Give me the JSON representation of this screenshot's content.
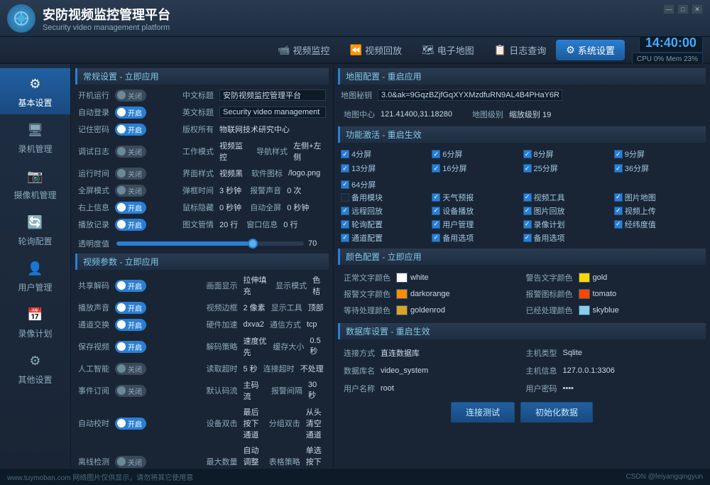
{
  "app": {
    "title": "安防视频监控管理平台",
    "subtitle": "Security video management platform",
    "time": "14:40:00",
    "cpu": "CPU 0%",
    "mem": "Mem 23%"
  },
  "nav": {
    "items": [
      {
        "label": "视频监控",
        "icon": "📹",
        "active": false
      },
      {
        "label": "视频回放",
        "icon": "⏪",
        "active": false
      },
      {
        "label": "电子地图",
        "icon": "🗺",
        "active": false
      },
      {
        "label": "日志查询",
        "icon": "📋",
        "active": false
      },
      {
        "label": "系统设置",
        "icon": "⚙",
        "active": true
      }
    ]
  },
  "sidebar": {
    "items": [
      {
        "label": "基本设置",
        "icon": "⚙",
        "active": true
      },
      {
        "label": "录机管理",
        "icon": "🖥",
        "active": false
      },
      {
        "label": "摄像机管理",
        "icon": "📷",
        "active": false
      },
      {
        "label": "轮询配置",
        "icon": "🔄",
        "active": false
      },
      {
        "label": "用户管理",
        "icon": "👤",
        "active": false
      },
      {
        "label": "录像计划",
        "icon": "📅",
        "active": false
      },
      {
        "label": "其他设置",
        "icon": "⚙",
        "active": false
      }
    ]
  },
  "sections": {
    "general": {
      "header": "常规设置 - 立即应用",
      "rows": [
        {
          "label": "开机运行",
          "type": "toggle",
          "value": "关闭",
          "on": false
        },
        {
          "label": "中文标题",
          "type": "text",
          "value": "安防视频监控管理平台"
        },
        {
          "label": "自动登录",
          "type": "toggle",
          "value": "开启",
          "on": true
        },
        {
          "label": "英文标题",
          "type": "text",
          "value": "Security video management platform"
        },
        {
          "label": "记住密码",
          "type": "toggle",
          "value": "开启",
          "on": true
        },
        {
          "label": "版权所有",
          "type": "text",
          "value": "物联网技术研究中心"
        },
        {
          "label": "调试日志",
          "type": "toggle",
          "value": "关闭",
          "on": false
        },
        {
          "label": "工作模式",
          "type": "text",
          "value": "视频监控"
        },
        {
          "label": "导航样式",
          "type": "text",
          "value": "左侧+左侧"
        },
        {
          "label": "运行时间",
          "type": "toggle",
          "value": "关闭",
          "on": false
        },
        {
          "label": "界面样式",
          "type": "text",
          "value": "视频黑"
        },
        {
          "label": "软件图标",
          "type": "text",
          "value": "/logo.png"
        },
        {
          "label": "全屏模式",
          "type": "toggle",
          "value": "关闭",
          "on": false
        },
        {
          "label": "弹框时间",
          "type": "text",
          "value": "3 秒钟"
        },
        {
          "label": "报警声音",
          "type": "text",
          "value": "0 次"
        },
        {
          "label": "右上信息",
          "type": "toggle",
          "value": "开启",
          "on": true
        },
        {
          "label": "鼠标隐藏",
          "type": "text",
          "value": "0 秒钟"
        },
        {
          "label": "自动全屏",
          "type": "text",
          "value": "0 秒钟"
        },
        {
          "label": "播放记录",
          "type": "toggle",
          "value": "开启",
          "on": true
        },
        {
          "label": "图文管情",
          "type": "text",
          "value": "20 行"
        },
        {
          "label": "窗口信息",
          "type": "text",
          "value": "0 行"
        }
      ]
    },
    "slider": {
      "label": "透明度值",
      "value": 70
    },
    "video": {
      "header": "视频参数 - 立即应用",
      "rows": [
        {
          "label": "共享解码",
          "type": "toggle",
          "value": "开启",
          "on": true
        },
        {
          "label": "画面显示",
          "type": "text",
          "value": "拉伸填充"
        },
        {
          "label": "显示模式",
          "type": "text",
          "value": "色桔"
        },
        {
          "label": "播放声音",
          "type": "toggle",
          "value": "开启",
          "on": true
        },
        {
          "label": "视频边框",
          "type": "text",
          "value": "2 像素"
        },
        {
          "label": "显示工具",
          "type": "text",
          "value": "顶部"
        },
        {
          "label": "通道交换",
          "type": "toggle",
          "value": "开启",
          "on": true
        },
        {
          "label": "硬件加速",
          "type": "text",
          "value": "dxva2"
        },
        {
          "label": "通信方式",
          "type": "text",
          "value": "tcp"
        },
        {
          "label": "保存视频",
          "type": "toggle",
          "value": "开启",
          "on": true
        },
        {
          "label": "解码策略",
          "type": "text",
          "value": "速度优先"
        },
        {
          "label": "缓存大小",
          "type": "text",
          "value": "0.5 秒"
        },
        {
          "label": "人工智能",
          "type": "toggle",
          "value": "关闭",
          "on": false
        },
        {
          "label": "读取超时",
          "type": "text",
          "value": "5 秒"
        },
        {
          "label": "连接超时",
          "type": "text",
          "value": "不处理"
        },
        {
          "label": "事件订阅",
          "type": "toggle",
          "value": "关闭",
          "on": false
        },
        {
          "label": "默认码流",
          "type": "text",
          "value": "主码流"
        },
        {
          "label": "报警间隔",
          "type": "text",
          "value": "30 秒"
        },
        {
          "label": "自动校时",
          "type": "toggle",
          "value": "开启",
          "on": true
        },
        {
          "label": "设备双击",
          "type": "text",
          "value": "最后按下通道"
        },
        {
          "label": "分组双击",
          "type": "text",
          "value": "从头清空通道"
        },
        {
          "label": "离线检测",
          "type": "toggle",
          "value": "关闭",
          "on": false
        },
        {
          "label": "最大数量",
          "type": "text",
          "value": "自动调整数量"
        },
        {
          "label": "表格策略",
          "type": "text",
          "value": "单选按下编辑"
        }
      ]
    },
    "map": {
      "header": "地图配置 - 重启应用",
      "key_label": "地图秘钥",
      "key_value": "3.0&ak=9GqzBZjfGqXYXMzdfuRN9AL4B4PHaY6R",
      "center_label": "地图中心",
      "center_value": "121.41400,31.18280",
      "level_label": "地图级别",
      "level_value": "缩放级别 19"
    },
    "features": {
      "header": "功能激活 - 重启生效",
      "items": [
        {
          "label": "4分屏",
          "checked": true
        },
        {
          "label": "6分屏",
          "checked": true
        },
        {
          "label": "8分屏",
          "checked": true
        },
        {
          "label": "9分屏",
          "checked": true
        },
        {
          "label": "13分屏",
          "checked": true
        },
        {
          "label": "16分屏",
          "checked": true
        },
        {
          "label": "25分屏",
          "checked": true
        },
        {
          "label": "36分屏",
          "checked": true
        },
        {
          "label": "64分屏",
          "checked": true
        },
        {
          "label": "备用模块",
          "checked": false
        },
        {
          "label": "天气预报",
          "checked": true
        },
        {
          "label": "视频工具",
          "checked": true
        },
        {
          "label": "图片地图",
          "checked": true
        },
        {
          "label": "远程回放",
          "checked": true
        },
        {
          "label": "设备播放",
          "checked": true
        },
        {
          "label": "图片回放",
          "checked": true
        },
        {
          "label": "视频上传",
          "checked": true
        },
        {
          "label": "轮询配置",
          "checked": true
        },
        {
          "label": "用户管理",
          "checked": true
        },
        {
          "label": "录像计划",
          "checked": true
        },
        {
          "label": "经纬度值",
          "checked": true
        },
        {
          "label": "通道配置",
          "checked": true
        },
        {
          "label": "备用选项",
          "checked": true
        },
        {
          "label": "备用选项",
          "checked": true
        }
      ]
    },
    "colors": {
      "header": "颜色配置 - 立即应用",
      "items": [
        {
          "label": "正常文字颜色",
          "color": "#ffffff",
          "name": "white",
          "side": "left"
        },
        {
          "label": "警告文字颜色",
          "color": "#ffd700",
          "name": "gold",
          "side": "right"
        },
        {
          "label": "报警文字颜色",
          "color": "#ff8c00",
          "name": "darkorange",
          "side": "left"
        },
        {
          "label": "报警图标颜色",
          "color": "#ff4500",
          "name": "tomato",
          "side": "right"
        },
        {
          "label": "等待处理颜色",
          "color": "#daa520",
          "name": "goldenrod",
          "side": "left"
        },
        {
          "label": "已经处理颜色",
          "color": "#87ceeb",
          "name": "skyblue",
          "side": "right"
        }
      ]
    },
    "database": {
      "header": "数据库设置 - 重启生效",
      "rows": [
        {
          "label": "连接方式",
          "value": "直连数据库"
        },
        {
          "label": "主机类型",
          "value": "Sqlite"
        },
        {
          "label": "数据库名",
          "value": "video_system"
        },
        {
          "label": "主机信息",
          "value": "127.0.0.1:3306"
        },
        {
          "label": "用户名称",
          "value": "root"
        },
        {
          "label": "用户密码",
          "value": "••••"
        }
      ],
      "btn_connect": "连接测试",
      "btn_init": "初始化数据"
    }
  },
  "bottom": {
    "left": "www.tuymoban.com 网络图片仅供显示，请勿将其它使用意",
    "right": "CSDN @feiyangqingyun"
  },
  "colors": {
    "accent": "#2a7fd4",
    "bg_dark": "#0d1a28",
    "bg_mid": "#192535",
    "bg_light": "#1e2e42",
    "text_normal": "#c8d8e8",
    "text_muted": "#8aaabb",
    "toggle_on": "#2a7fd4",
    "toggle_off": "#3a4a5a"
  }
}
